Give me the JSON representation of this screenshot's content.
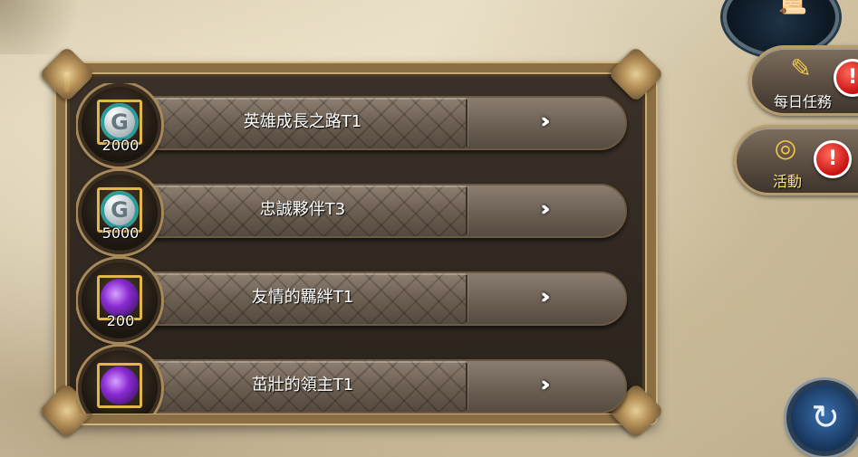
{
  "side_menu": {
    "scroll_icon": "scroll-icon",
    "daily_task": {
      "label": "每日任務",
      "icon": "quest-paper-icon",
      "alert": "!"
    },
    "event": {
      "label": "活動",
      "icon": "target-icon",
      "alert": "!"
    }
  },
  "refresh_icon": "refresh-icon",
  "achievements": [
    {
      "title": "英雄成長之路T1",
      "reward_amount": "2000",
      "reward_icon": "silver-coin-icon",
      "arrow": "›››"
    },
    {
      "title": "忠誠夥伴T3",
      "reward_amount": "5000",
      "reward_icon": "silver-coin-icon",
      "arrow": "›››"
    },
    {
      "title": "友情的羈絆T1",
      "reward_amount": "200",
      "reward_icon": "purple-gem-icon",
      "arrow": "›››"
    },
    {
      "title": "茁壯的領主T1",
      "reward_amount": "",
      "reward_icon": "purple-gem-icon",
      "arrow": "›››"
    }
  ]
}
